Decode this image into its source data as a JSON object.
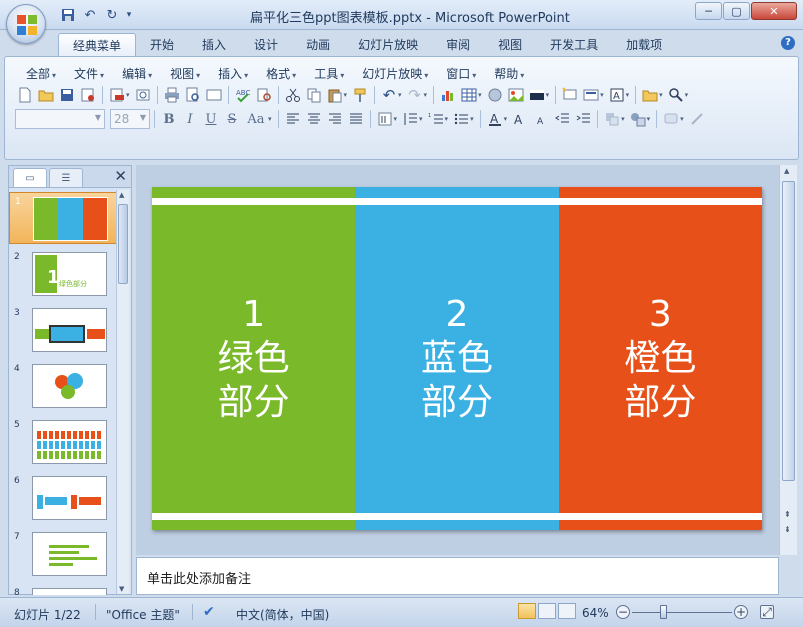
{
  "window": {
    "title": "扁平化三色ppt图表模板.pptx - Microsoft PowerPoint",
    "minimize_label": "─",
    "maximize_label": "▢",
    "close_label": "✕"
  },
  "quick_access": {
    "icons": [
      "save-icon",
      "undo-icon",
      "redo-icon"
    ],
    "customize_label": "▾"
  },
  "ribbon_tabs": [
    "经典菜单",
    "开始",
    "插入",
    "设计",
    "动画",
    "幻灯片放映",
    "审阅",
    "视图",
    "开发工具",
    "加载项"
  ],
  "active_tab": "经典菜单",
  "classic_menu": [
    "全部",
    "文件",
    "编辑",
    "视图",
    "插入",
    "格式",
    "工具",
    "幻灯片放映",
    "窗口",
    "帮助"
  ],
  "font_size_value": "28",
  "format_buttons": [
    "B",
    "I",
    "U",
    "S",
    "Aa"
  ],
  "left_pane": {
    "close_label": "✕",
    "slide_numbers": [
      "1",
      "2",
      "3",
      "4",
      "5",
      "6",
      "7",
      "8"
    ],
    "selected": "1"
  },
  "slide": {
    "panels": [
      {
        "number": "1",
        "line1": "绿色",
        "line2": "部分",
        "color": "#7ab929"
      },
      {
        "number": "2",
        "line1": "蓝色",
        "line2": "部分",
        "color": "#3bb0e2"
      },
      {
        "number": "3",
        "line1": "橙色",
        "line2": "部分",
        "color": "#e8501a"
      }
    ]
  },
  "thumb_texts": {
    "slide2": "绿色部分",
    "slide2_num": "1"
  },
  "notes_placeholder": "单击此处添加备注",
  "status": {
    "slide_info": "幻灯片 1/22",
    "theme": "\"Office 主题\"",
    "language": "中文(简体，中国)",
    "zoom": "64%"
  }
}
